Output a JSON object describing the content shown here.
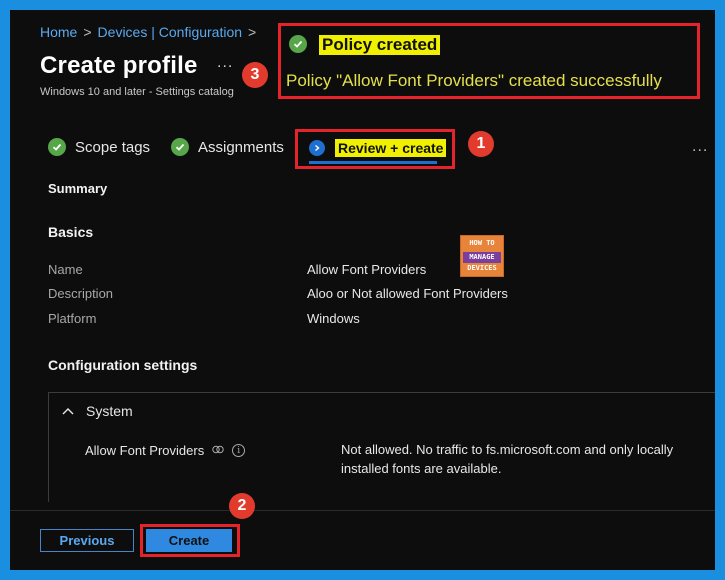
{
  "breadcrumb": {
    "home": "Home",
    "devices": "Devices | Configuration",
    "chevron": ">"
  },
  "header": {
    "title": "Create profile",
    "more": "...",
    "subtitle": "Windows 10 and later - Settings catalog"
  },
  "notification": {
    "title": "Policy created",
    "message": "Policy \"Allow Font Providers\" created successfully"
  },
  "callouts": {
    "one": "1",
    "two": "2",
    "three": "3"
  },
  "tabs": [
    {
      "label": "Scope tags",
      "state": "complete"
    },
    {
      "label": "Assignments",
      "state": "complete"
    },
    {
      "label": "Review + create",
      "state": "active"
    }
  ],
  "tabs_more": "...",
  "summary": {
    "heading": "Summary"
  },
  "basics": {
    "heading": "Basics",
    "rows": [
      {
        "label": "Name",
        "value": "Allow Font Providers"
      },
      {
        "label": "Description",
        "value": "Aloo or Not allowed Font Providers"
      },
      {
        "label": "Platform",
        "value": "Windows"
      }
    ]
  },
  "watermark": {
    "line1": "HOW TO",
    "line2": "MANAGE",
    "line3": "DEVICES"
  },
  "config": {
    "heading": "Configuration settings",
    "group": "System",
    "setting_name": "Allow Font Providers",
    "setting_value": "Not allowed. No traffic to fs.microsoft.com and only locally installed fonts are available."
  },
  "footer": {
    "previous_label": "Previous",
    "create_label": "Create"
  },
  "colors": {
    "accent": "#1f6fd0",
    "success": "#57a64a",
    "highlight": "#f0f000",
    "callout": "#e23b2e"
  }
}
